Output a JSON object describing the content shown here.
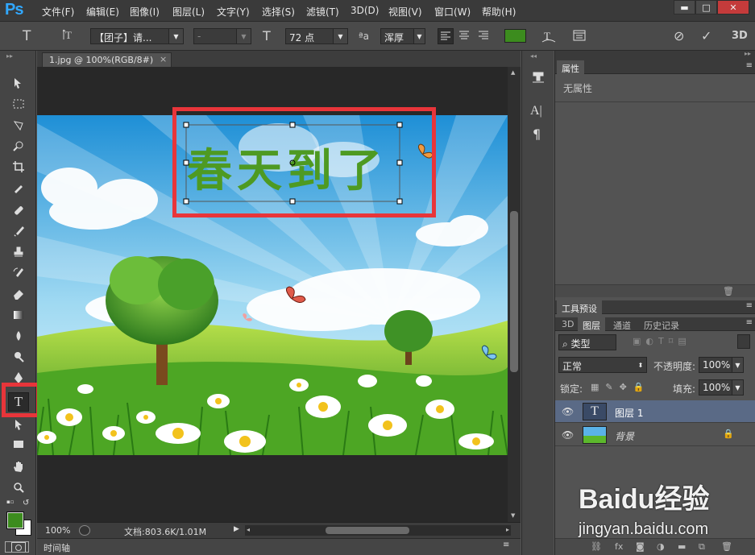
{
  "app": {
    "logo": "Ps"
  },
  "menu": [
    "文件(F)",
    "编辑(E)",
    "图像(I)",
    "图层(L)",
    "文字(Y)",
    "选择(S)",
    "滤镜(T)",
    "3D(D)",
    "视图(V)",
    "窗口(W)",
    "帮助(H)"
  ],
  "window_controls": {
    "minimize": "▬",
    "maximize": "□",
    "close": "✕"
  },
  "options": {
    "tool_glyph": "T",
    "font_family": "【团子】请...",
    "font_style": "-",
    "size_glyph": "T",
    "font_size": "72 点",
    "aa_label": "ªa",
    "anti_alias": "浑厚",
    "text_color": "#3c8c1e",
    "commit_glyph": "✓",
    "cancel_glyph": "⊘",
    "threed_label": "3D"
  },
  "document": {
    "tab_title": "1.jpg @ 100%(RGB/8#)",
    "tab_close": "×",
    "image_text": "春天到了"
  },
  "status": {
    "zoom": "100%",
    "doc_info": "文档:803.6K/1.01M"
  },
  "timeline": {
    "label": "时间轴"
  },
  "properties": {
    "tab": "属性",
    "empty": "无属性"
  },
  "tool_presets": {
    "tab": "工具预设"
  },
  "layers_panel": {
    "tabs": [
      "3D",
      "图层",
      "通道",
      "历史记录"
    ],
    "filter": "类型",
    "blend_mode": "正常",
    "opacity_label": "不透明度:",
    "opacity": "100%",
    "lock_label": "锁定:",
    "fill_label": "填充:",
    "fill": "100%",
    "layers": [
      {
        "name": "图层 1",
        "kind": "text",
        "selected": true
      },
      {
        "name": "背景",
        "kind": "image",
        "locked": true
      }
    ]
  },
  "watermark": {
    "brand": "Baidu经验",
    "url": "jingyan.baidu.com"
  },
  "colors": {
    "foreground": "#3c8c1e",
    "background": "#ffffff",
    "highlight": "#e8353a"
  }
}
